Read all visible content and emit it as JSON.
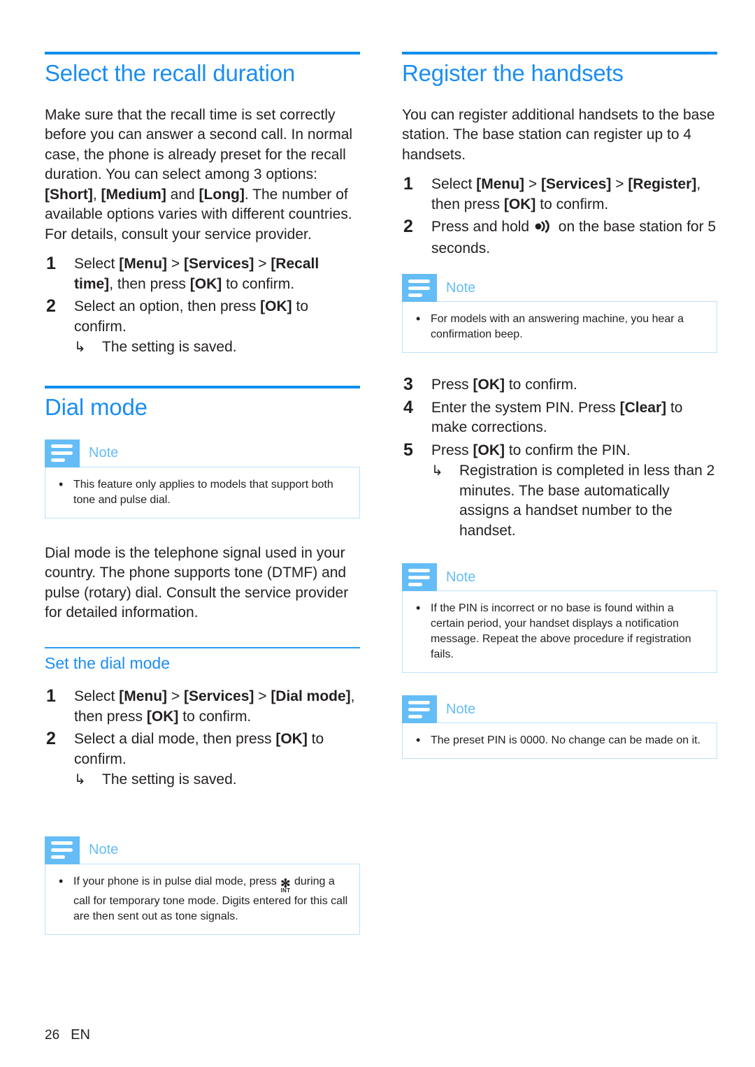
{
  "theme": {
    "heading_blue": "#1b8df2",
    "rule_blue": "#0f8ef0",
    "note_icon_blue": "#64bdf7",
    "note_border_blue": "#bfe1f8",
    "text_black": "#231f20"
  },
  "left_column": {
    "section1": {
      "title": "Select the recall duration",
      "intro_parts": {
        "p1_a": "Make sure that the recall time is set correctly before you can answer a second call. In normal case, the phone is already preset for the recall duration. You can select among 3 options: ",
        "opt1": "[Short]",
        "sep1": ", ",
        "opt2": "[Medium]",
        "sep2": " and ",
        "opt3": "[Long]",
        "p1_b": ". The number of available options varies with different countries. For details, consult your service provider."
      },
      "steps": [
        {
          "num": "1",
          "t_a": "Select ",
          "menu": "[Menu]",
          "gt1": " > ",
          "services": "[Services]",
          "gt2": " > ",
          "target": "[Recall time]",
          "t_b": ", then press ",
          "ok": "[OK]",
          "t_c": " to confirm."
        },
        {
          "num": "2",
          "t_a": "Select an option, then press ",
          "ok": "[OK]",
          "t_c": " to confirm.",
          "sub_arrow": "↳",
          "sub_text": "The setting is saved."
        }
      ]
    },
    "section2": {
      "title": "Dial mode",
      "note1": {
        "label": "Note",
        "items": [
          "This feature only applies to models that support both tone and pulse dial."
        ]
      },
      "paragraph": "Dial mode is the telephone signal used in your country. The phone supports tone (DTMF) and pulse (rotary) dial. Consult the service provider for detailed information.",
      "subsection": {
        "title": "Set the dial mode",
        "steps": [
          {
            "num": "1",
            "t_a": "Select ",
            "menu": "[Menu]",
            "gt1": " > ",
            "services": "[Services]",
            "gt2": " > ",
            "target": "[Dial mode]",
            "t_b": ", then press ",
            "ok": "[OK]",
            "t_c": " to confirm."
          },
          {
            "num": "2",
            "t_a": "Select a dial mode, then press ",
            "ok": "[OK]",
            "t_c": " to confirm.",
            "sub_arrow": "↳",
            "sub_text": "The setting is saved."
          }
        ]
      },
      "note2": {
        "label": "Note",
        "item_a": "If your phone is in pulse dial mode, press ",
        "glyph_star": "✻",
        "glyph_int": "INT",
        "item_b": " during a call for temporary tone mode. Digits entered for this call are then sent out as tone signals."
      }
    }
  },
  "right_column": {
    "section1": {
      "title": "Register the handsets",
      "paragraph": "You can register additional handsets to the base station. The base station can register up to 4 handsets.",
      "steps_top": [
        {
          "num": "1",
          "t_a": "Select ",
          "menu": "[Menu]",
          "gt1": " > ",
          "services": "[Services]",
          "gt2": " > ",
          "target": "[Register]",
          "t_b": ", then press ",
          "ok": "[OK]",
          "t_c": " to confirm."
        },
        {
          "num": "2",
          "t_a": "Press and hold ",
          "glyph": "paging-icon",
          "t_c": " on the base station for 5 seconds."
        }
      ],
      "note1": {
        "label": "Note",
        "items": [
          "For models with an answering machine, you hear a confirmation beep."
        ]
      },
      "steps_bottom": [
        {
          "num": "3",
          "t_a": "Press ",
          "ok": "[OK]",
          "t_c": " to confirm."
        },
        {
          "num": "4",
          "t_a": "Enter the system PIN. Press ",
          "clear": "[Clear]",
          "t_c": " to make corrections."
        },
        {
          "num": "5",
          "t_a": "Press ",
          "ok": "[OK]",
          "t_c": " to confirm the PIN.",
          "sub_arrow": "↳",
          "sub_text": "Registration is completed in less than 2 minutes. The base automatically assigns a handset number to the handset."
        }
      ],
      "note2": {
        "label": "Note",
        "items": [
          "If the PIN is incorrect or no base is found within a certain period, your handset displays a notification message. Repeat the above procedure if registration fails."
        ]
      },
      "note3": {
        "label": "Note",
        "items": [
          "The preset PIN is 0000. No change can be made on it."
        ]
      }
    }
  },
  "footer": {
    "page_number": "26",
    "language": "EN"
  }
}
